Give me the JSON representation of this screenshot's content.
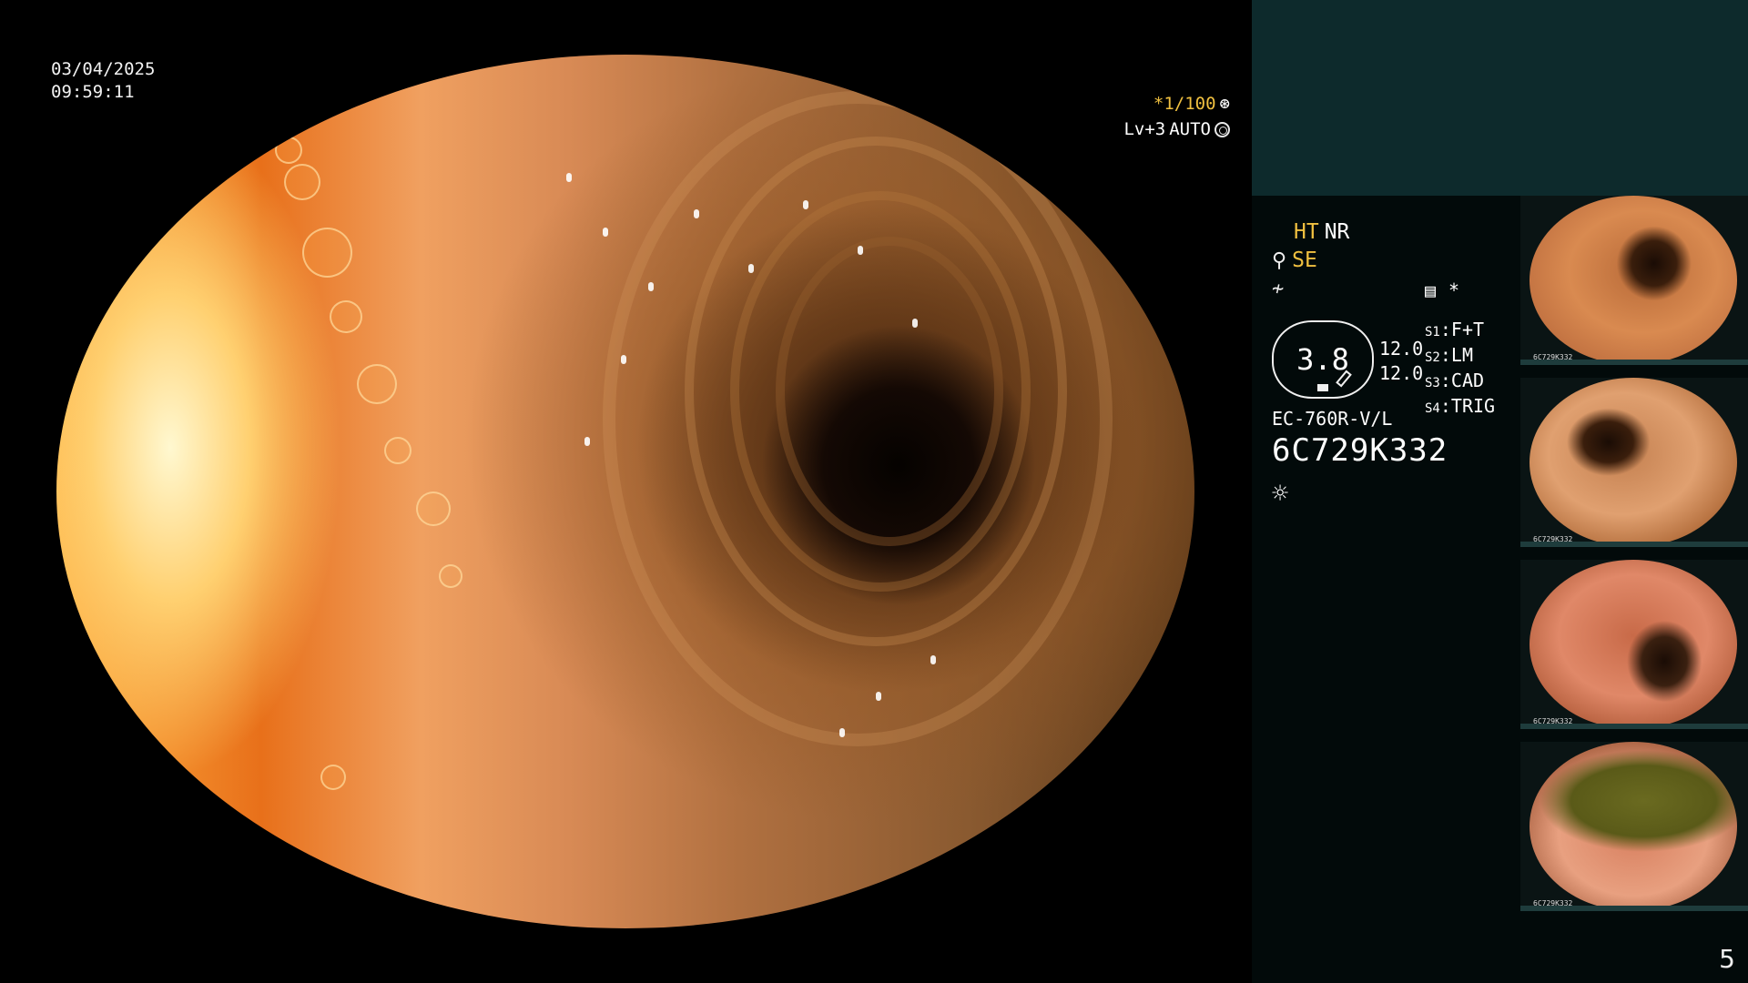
{
  "datetime": {
    "date": "03/04/2025",
    "time": "09:59:11"
  },
  "shutter": {
    "speed": "*1/100",
    "level": "Lv+3",
    "mode": "AUTO",
    "speed_icon": "aperture-icon",
    "mode_icon": "ring-icon"
  },
  "panel": {
    "ht": "HT",
    "nr": "NR",
    "se": "SE",
    "se_icon": "scope-icon",
    "wave_icon": "signal-icon",
    "memo_icon": "memo-icon",
    "star": "*",
    "enhancement": "3.8",
    "value1": "12.0",
    "value2": "12.0",
    "modes": [
      {
        "key": "S1",
        "value": "F+T"
      },
      {
        "key": "S2",
        "value": "LM"
      },
      {
        "key": "S3",
        "value": "CAD"
      },
      {
        "key": "S4",
        "value": "TRIG"
      }
    ],
    "model": "EC-760R-V/L",
    "serial": "6C729K332",
    "light_icon": "sun-icon"
  },
  "thumbnails": [
    {
      "caption_id": "6C729K332"
    },
    {
      "caption_id": "6C729K332"
    },
    {
      "caption_id": "6C729K332"
    },
    {
      "caption_id": "6C729K332"
    }
  ],
  "page_number": "5",
  "colors": {
    "accent_yellow": "#f0c040",
    "panel_top": "#0d2a2c",
    "panel": "#020a0a"
  }
}
